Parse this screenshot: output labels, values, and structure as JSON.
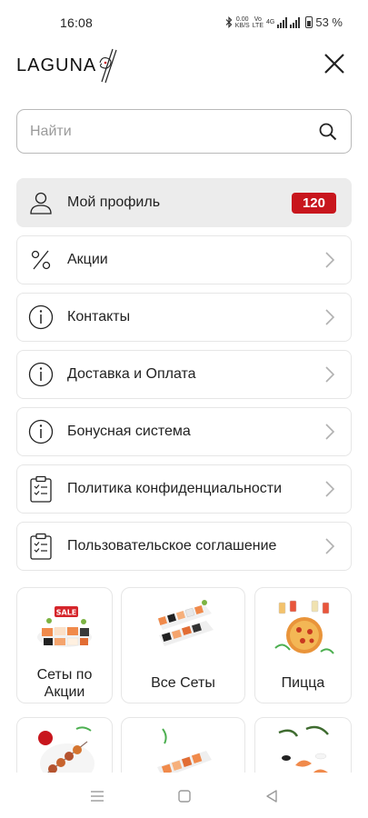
{
  "status_bar": {
    "time": "16:08",
    "net_speed_top": "0.00",
    "net_speed_bottom": "KB/S",
    "volte_top": "Vo",
    "volte_bottom": "LTE",
    "network": "4G",
    "battery": "53 %"
  },
  "header": {
    "logo_text": "LAGUNA"
  },
  "search": {
    "placeholder": "Найти"
  },
  "menu": {
    "items": [
      {
        "label": "Мой профиль",
        "icon": "user-icon",
        "badge": "120"
      },
      {
        "label": "Акции",
        "icon": "percent-icon"
      },
      {
        "label": "Контакты",
        "icon": "info-icon"
      },
      {
        "label": "Доставка и Оплата",
        "icon": "info-icon"
      },
      {
        "label": "Бонусная система",
        "icon": "info-icon"
      },
      {
        "label": "Политика конфиденциальности",
        "icon": "clipboard-icon"
      },
      {
        "label": "Пользовательское соглашение",
        "icon": "clipboard-icon"
      }
    ]
  },
  "categories": [
    {
      "label": "Сеты по Акции"
    },
    {
      "label": "Все Сеты"
    },
    {
      "label": "Пицца"
    },
    {
      "label": ""
    },
    {
      "label": ""
    },
    {
      "label": ""
    }
  ],
  "colors": {
    "accent": "#c8161d",
    "profile_bg": "#ececec",
    "border": "#e6e6e6"
  }
}
